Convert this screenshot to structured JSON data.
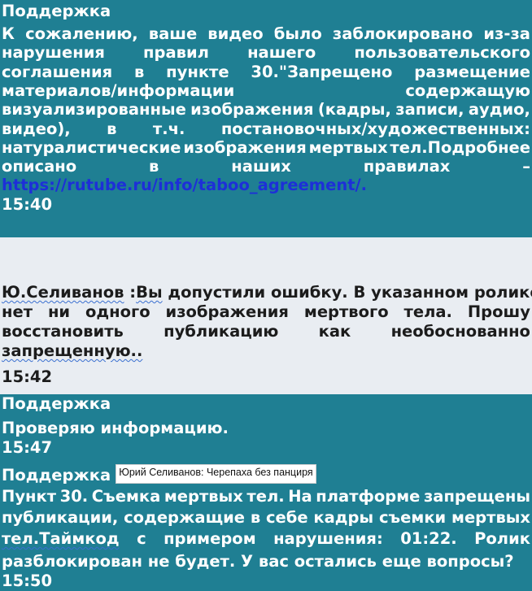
{
  "msg1": {
    "sender": "Поддержка",
    "lines": [
      [
        "К",
        "сожалению,",
        "ваше",
        "видео",
        "было",
        "заблокировано",
        "из-за"
      ],
      [
        "нарушения",
        "правил",
        "нашего",
        "пользовательского"
      ],
      [
        "соглашения",
        "в",
        "пункте",
        "30.\"Запрещено",
        "размещение"
      ],
      [
        "материалов/информации",
        "содержащую"
      ],
      [
        "визуализированные",
        "изображения",
        "(кадры,",
        "записи,",
        "аудио,"
      ],
      [
        "видео),",
        "в",
        "т.ч.",
        "постановочных/художественных:"
      ],
      [
        "натуралистические",
        "изображения",
        "мертвых",
        "тел.Подробнее"
      ],
      [
        "описано",
        "в",
        "наших",
        "правилах",
        "–"
      ]
    ],
    "link": "https://rutube.ru/info/taboo_agreement/.",
    "time": "15:40"
  },
  "msg2": {
    "author": "Ю.Селиванов",
    "sep": " :",
    "first_word": "Вы",
    "line1_rest": " допустили ошибку. В указанном ролике",
    "lines": [
      [
        "нет",
        "ни",
        "одного",
        "изображения",
        "мертвого",
        "тела.",
        "Прошу"
      ],
      [
        "восстановить",
        "публикацию",
        "как",
        "необоснованно"
      ]
    ],
    "last_line": "запрещенную..",
    "time": "15:42"
  },
  "msg3": {
    "sender": "Поддержка",
    "text": "Проверяю информацию.",
    "time": "15:47"
  },
  "msg4": {
    "sender": "Поддержка",
    "caption": "Юрий Селиванов: Черепаха без панциря",
    "lines": [
      [
        "Пункт",
        "30.",
        "Съемка",
        "мертвых",
        "тел.",
        "На",
        "платформе",
        "запрещены"
      ],
      [
        "публикации,",
        "содержащие",
        "в",
        "себе",
        "кадры",
        "съемки",
        "мертвых"
      ],
      [
        "тел.Таймкод",
        "с",
        "примером",
        "нарушения:",
        "01:22.",
        "Ролик"
      ]
    ],
    "last_line": "разблокирован не будет. У вас остались еще вопросы?",
    "time": "15:50"
  }
}
